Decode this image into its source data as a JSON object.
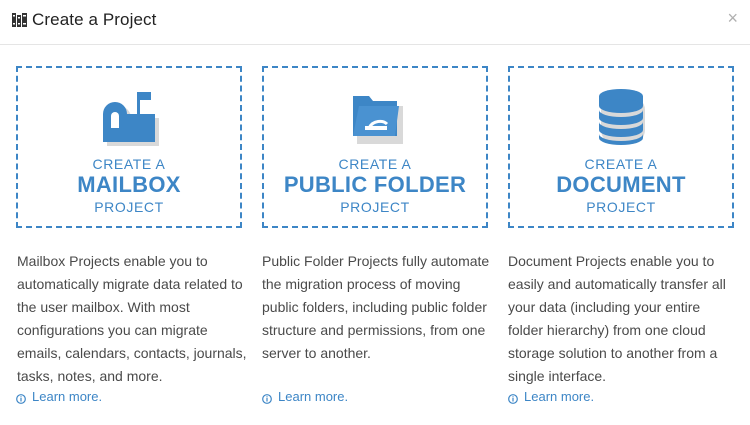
{
  "dialog": {
    "title": "Create a Project",
    "close_label": "×",
    "title_icon": "books-icon"
  },
  "cards": [
    {
      "icon": "mailbox-icon",
      "line1": "CREATE A",
      "line2": "MAILBOX",
      "line3": "PROJECT",
      "description": "Mailbox Projects enable you to automatically migrate data related to the user mailbox. With most configurations you can migrate emails, calendars, contacts, journals, tasks, notes, and more.",
      "learn_more": "Learn more."
    },
    {
      "icon": "folder-icon",
      "line1": "CREATE A",
      "line2": "PUBLIC FOLDER",
      "line3": "PROJECT",
      "description": "Public Folder Projects fully automate the migration process of moving public folders, including public folder structure and permissions, from one server to another.",
      "learn_more": "Learn more."
    },
    {
      "icon": "database-icon",
      "line1": "CREATE A",
      "line2": "DOCUMENT",
      "line3": "PROJECT",
      "description": "Document Projects enable you to easily and automatically transfer all your data (including your entire folder hierarchy) from one cloud storage solution to another from a single interface.",
      "learn_more": "Learn more."
    }
  ],
  "colors": {
    "accent": "#3d86c6",
    "icon_shadow": "#d9d9d9",
    "text": "#4a4a4a"
  }
}
